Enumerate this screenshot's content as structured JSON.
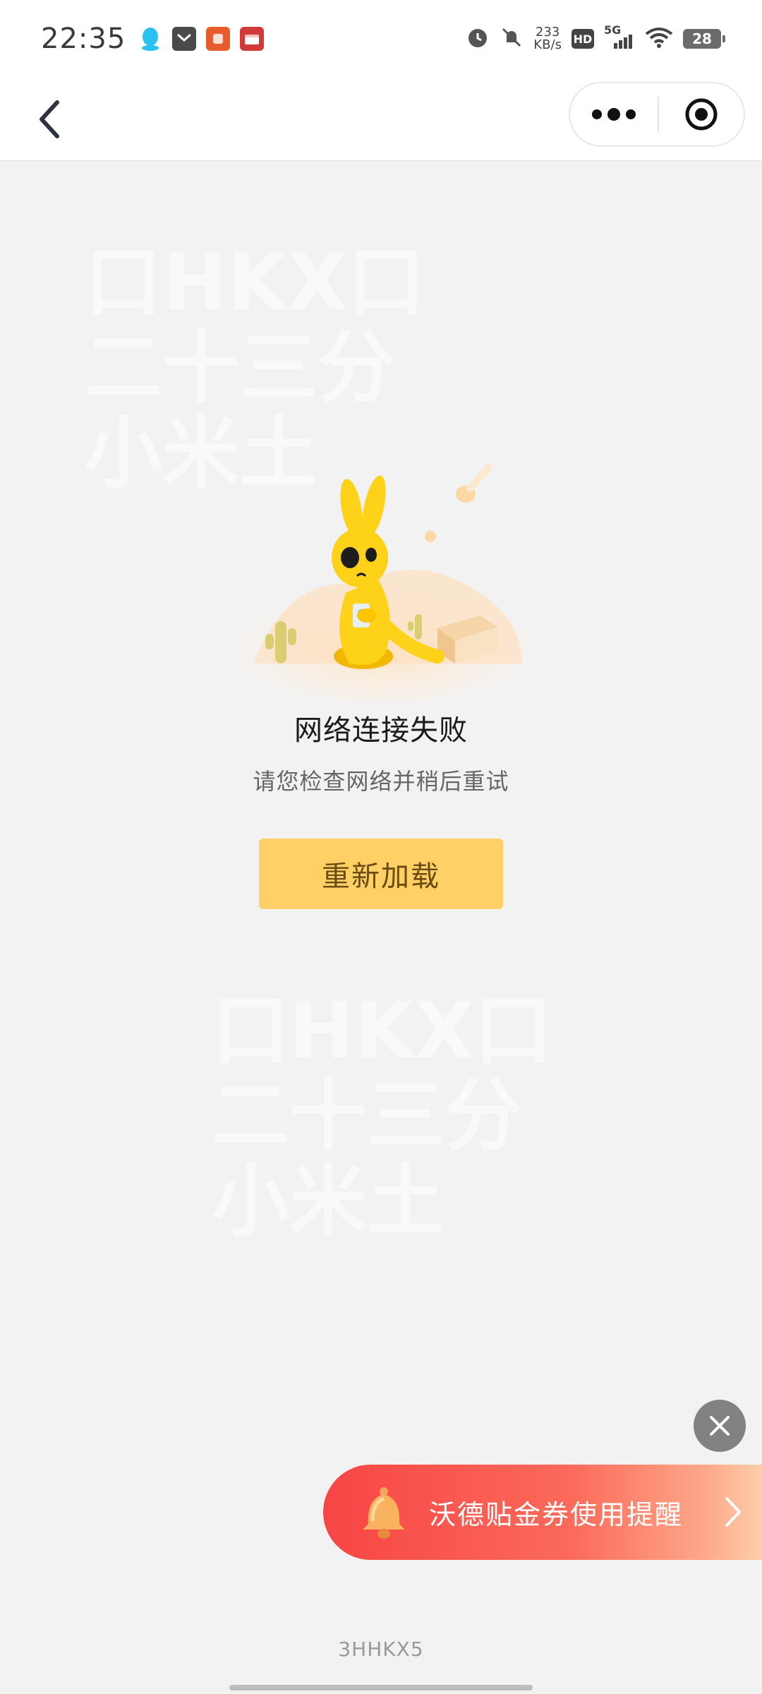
{
  "status_bar": {
    "time": "22:35",
    "network_speed_value": "233",
    "network_speed_unit": "KB/s",
    "hd_label": "HD",
    "signal_label": "5G",
    "battery": "28",
    "icons": [
      "qq-icon",
      "mail-icon",
      "app-icon",
      "calendar-icon",
      "alarm-icon",
      "mute-icon",
      "wifi-icon"
    ]
  },
  "nav": {
    "back_icon": "chevron-left-icon",
    "more_icon": "more-dots-icon",
    "close_icon": "target-circle-icon"
  },
  "watermark": {
    "text_a": "口HKX口\n二十三分\n小米土",
    "text_b": "口HKX口\n二十三分\n小米土"
  },
  "error": {
    "title": "网络连接失败",
    "subtitle": "请您检查网络并稍后重试",
    "reload_label": "重新加载",
    "illustration": "yellow-kangaroo-illustration"
  },
  "reminder": {
    "text": "沃德贴金券使用提醒",
    "icon": "bell-icon",
    "close_icon": "close-icon",
    "chevron_icon": "chevron-right-icon"
  },
  "footer": {
    "page_code": "3HHKX5"
  },
  "colors": {
    "background": "#f2f2f2",
    "reload_button": "#ffd066",
    "reminder_start": "#f74545",
    "reminder_end": "#ffd7b0"
  }
}
